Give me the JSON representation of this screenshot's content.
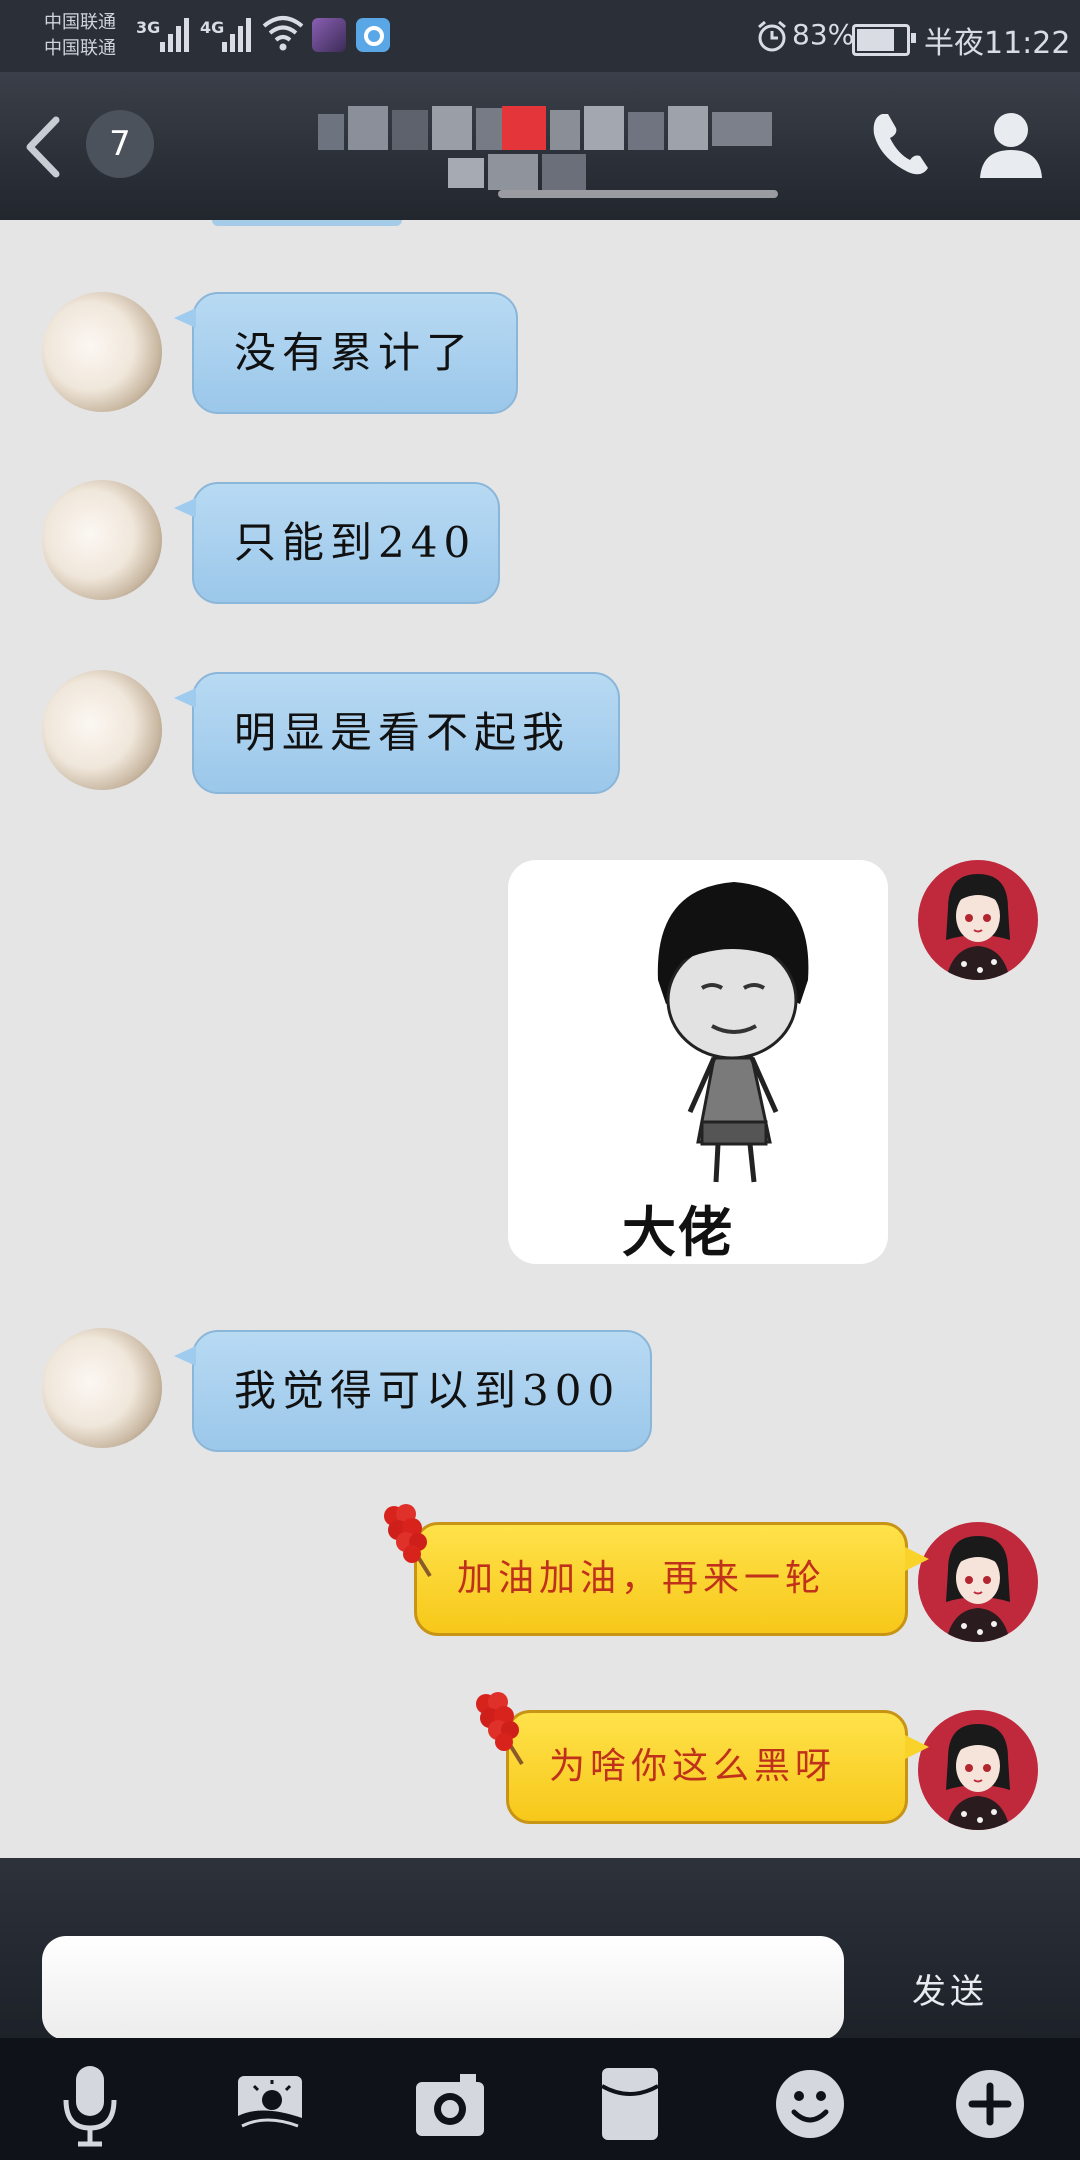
{
  "status_bar": {
    "carrier_1": "中国联通",
    "carrier_2": "中国联通",
    "network_1": "3G",
    "network_2": "4G",
    "battery_percent": "83%",
    "battery_level": 0.83,
    "time": "半夜11:22"
  },
  "header": {
    "unread_count": "7",
    "icons": [
      "back-icon",
      "phone-icon",
      "profile-icon"
    ]
  },
  "messages": [
    {
      "side": "in",
      "type": "text",
      "text": "没有累计了"
    },
    {
      "side": "in",
      "type": "text",
      "text": "只能到240"
    },
    {
      "side": "in",
      "type": "text",
      "text": "明显是看不起我"
    },
    {
      "side": "out",
      "type": "sticker",
      "caption": "大佬"
    },
    {
      "side": "in",
      "type": "text",
      "text": "我觉得可以到300"
    },
    {
      "side": "out",
      "type": "text",
      "text": "加油加油，再来一轮"
    },
    {
      "side": "out",
      "type": "text",
      "text": "为啥你这么黑呀"
    }
  ],
  "input": {
    "value": "",
    "placeholder": "",
    "send_label": "发送"
  },
  "toolbar": {
    "icons": [
      "microphone-icon",
      "image-icon",
      "camera-icon",
      "red-packet-icon",
      "emoji-icon",
      "plus-icon"
    ]
  },
  "colors": {
    "incoming_bubble": "#a8d0ef",
    "outgoing_bubble": "#fbd42a",
    "outgoing_text": "#c0311b",
    "header_bg": "#2a2f38"
  }
}
